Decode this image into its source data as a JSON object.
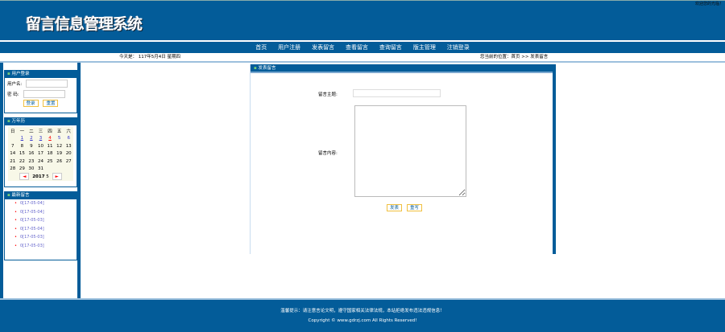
{
  "header": {
    "title": "留言信息管理系统",
    "top_right": "欢迎您的光临！"
  },
  "nav": [
    "首页",
    "用户注册",
    "发表留言",
    "查看留言",
    "查询留言",
    "版主管理",
    "注销登录"
  ],
  "date_text": "今天是： 117年5月4日  星期四",
  "location_text": "您当前的位置：首页 >> 发表留言",
  "login": {
    "title": "用户登录",
    "username_label": "用户名:",
    "password_label": "密  码:",
    "login_button": "登录",
    "reset_button": "重置"
  },
  "calendar": {
    "title": "万年历",
    "weekdays": [
      "日",
      "一",
      "二",
      "三",
      "四",
      "五",
      "六"
    ],
    "weeks": [
      [
        "",
        "1",
        "2",
        "3",
        "4",
        "5",
        "6"
      ],
      [
        "7",
        "8",
        "9",
        "10",
        "11",
        "12",
        "13"
      ],
      [
        "14",
        "15",
        "16",
        "17",
        "18",
        "19",
        "20"
      ],
      [
        "21",
        "22",
        "23",
        "24",
        "25",
        "26",
        "27"
      ],
      [
        "28",
        "29",
        "30",
        "31",
        "",
        "",
        ""
      ]
    ],
    "year": "2017",
    "month": "5",
    "prev": "◄",
    "next": "►"
  },
  "news": {
    "title": "最新留言",
    "items": [
      "0[17-05-04]",
      "0[17-05-04]",
      "0[17-05-03]",
      "0[17-05-04]",
      "0[17-05-03]",
      "0[17-05-03]"
    ]
  },
  "form": {
    "title": "发表留言",
    "subject_label": "留言主题:",
    "content_label": "留言内容:",
    "submit": "发表",
    "reset": "重写",
    "subject_value": "",
    "content_value": ""
  },
  "footer": {
    "notice": "温馨提示：请注意言论文明，遵守国家相关法律法规，本站拒绝发布违法违规信息！",
    "copyright": "Copyright © www.gdrzj.com All Rights Reserved!"
  }
}
